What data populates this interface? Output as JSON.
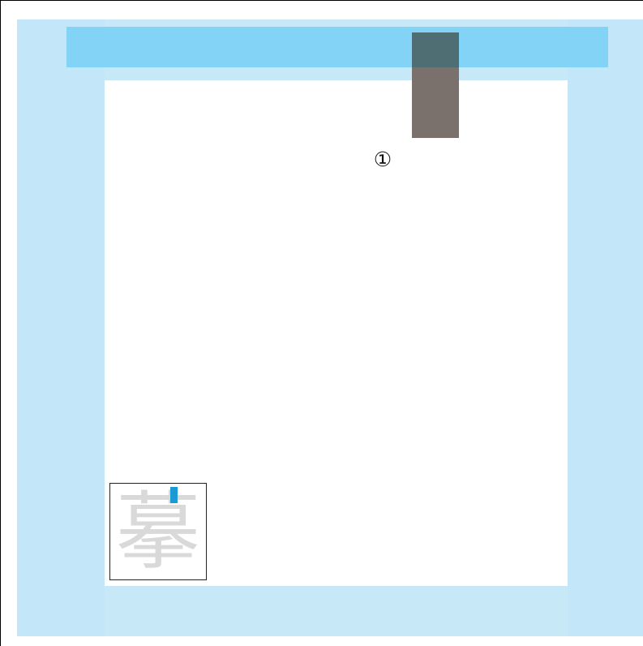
{
  "diagram": {
    "callout_label": "①",
    "glyph_char": "摹",
    "colors": {
      "outer_background": "#c3e7f8",
      "top_bar": "#83d3f7",
      "paper": "#ffffff",
      "tab_marker": "#7a716c",
      "glyph_accent": "#1b9ad6"
    }
  }
}
